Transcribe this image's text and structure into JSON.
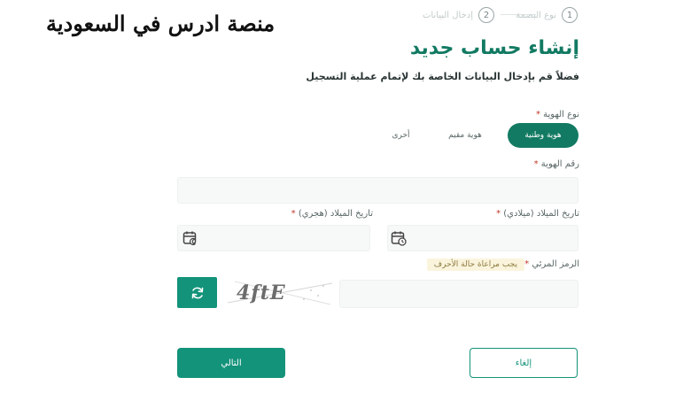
{
  "watermark": {
    "text": "منصة ادرس في السعودية"
  },
  "stepper": {
    "steps": [
      {
        "number": "1",
        "label": "نوع البصمة"
      },
      {
        "number": "2",
        "label": "إدخال البيانات"
      }
    ]
  },
  "header": {
    "title": "إنشاء حساب جديد",
    "subtitle": "فضلاً قم بإدخال البيانات الخاصة بك لإتمام عملية التسجيل"
  },
  "form": {
    "id_type": {
      "label": "نوع الهوية",
      "required_mark": "*",
      "options": [
        "هوية وطنية",
        "هوية مقيم",
        "أخرى"
      ],
      "selected": "هوية وطنية"
    },
    "id_number": {
      "label": "رقم الهوية",
      "required_mark": "*",
      "value": ""
    },
    "birth_gregorian": {
      "label": "تاريخ الميلاد (ميلادي)",
      "required_mark": "*",
      "value": ""
    },
    "birth_hijri": {
      "label": "تاريخ الميلاد (هجري)",
      "required_mark": "*",
      "value": ""
    },
    "captcha": {
      "label": "الرمز المرئي",
      "required_mark": "*",
      "hint": "يجب مراعاة حالة الأحرف",
      "image_text": "4ftE",
      "value": ""
    }
  },
  "actions": {
    "next_label": "التالي",
    "cancel_label": "إلغاء"
  },
  "colors": {
    "primary": "#13937a",
    "title": "#127a62",
    "hint_bg": "#fbf4dd"
  },
  "icons": {
    "calendar": "calendar-icon",
    "refresh": "refresh-icon"
  }
}
